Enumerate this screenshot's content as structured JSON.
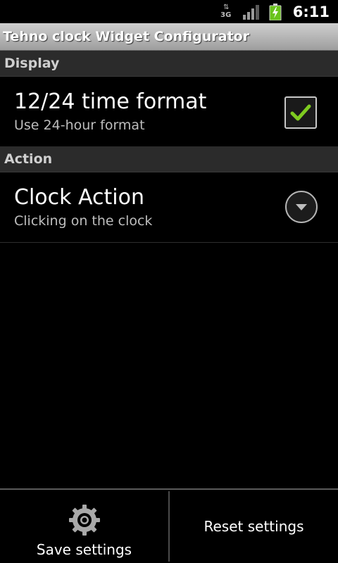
{
  "status_bar": {
    "network_label": "3G",
    "time": "6:11",
    "icons": [
      "data-activity-icon",
      "signal-icon",
      "battery-charging-icon"
    ]
  },
  "title_bar": {
    "title": "Tehno clock Widget Configurator"
  },
  "sections": {
    "display": {
      "header": "Display",
      "time_format": {
        "title": "12/24 time format",
        "summary": "Use 24-hour format",
        "checked": true
      }
    },
    "action": {
      "header": "Action",
      "clock_action": {
        "title": "Clock Action",
        "summary": "Clicking on the clock",
        "icon": "dropdown-icon"
      }
    }
  },
  "bottom_bar": {
    "save_label": "Save settings",
    "reset_label": "Reset settings",
    "save_icon": "gear-icon"
  },
  "colors": {
    "background": "#000000",
    "check_green": "#7ecb20",
    "section_header_bg": "#2b2b2b"
  }
}
